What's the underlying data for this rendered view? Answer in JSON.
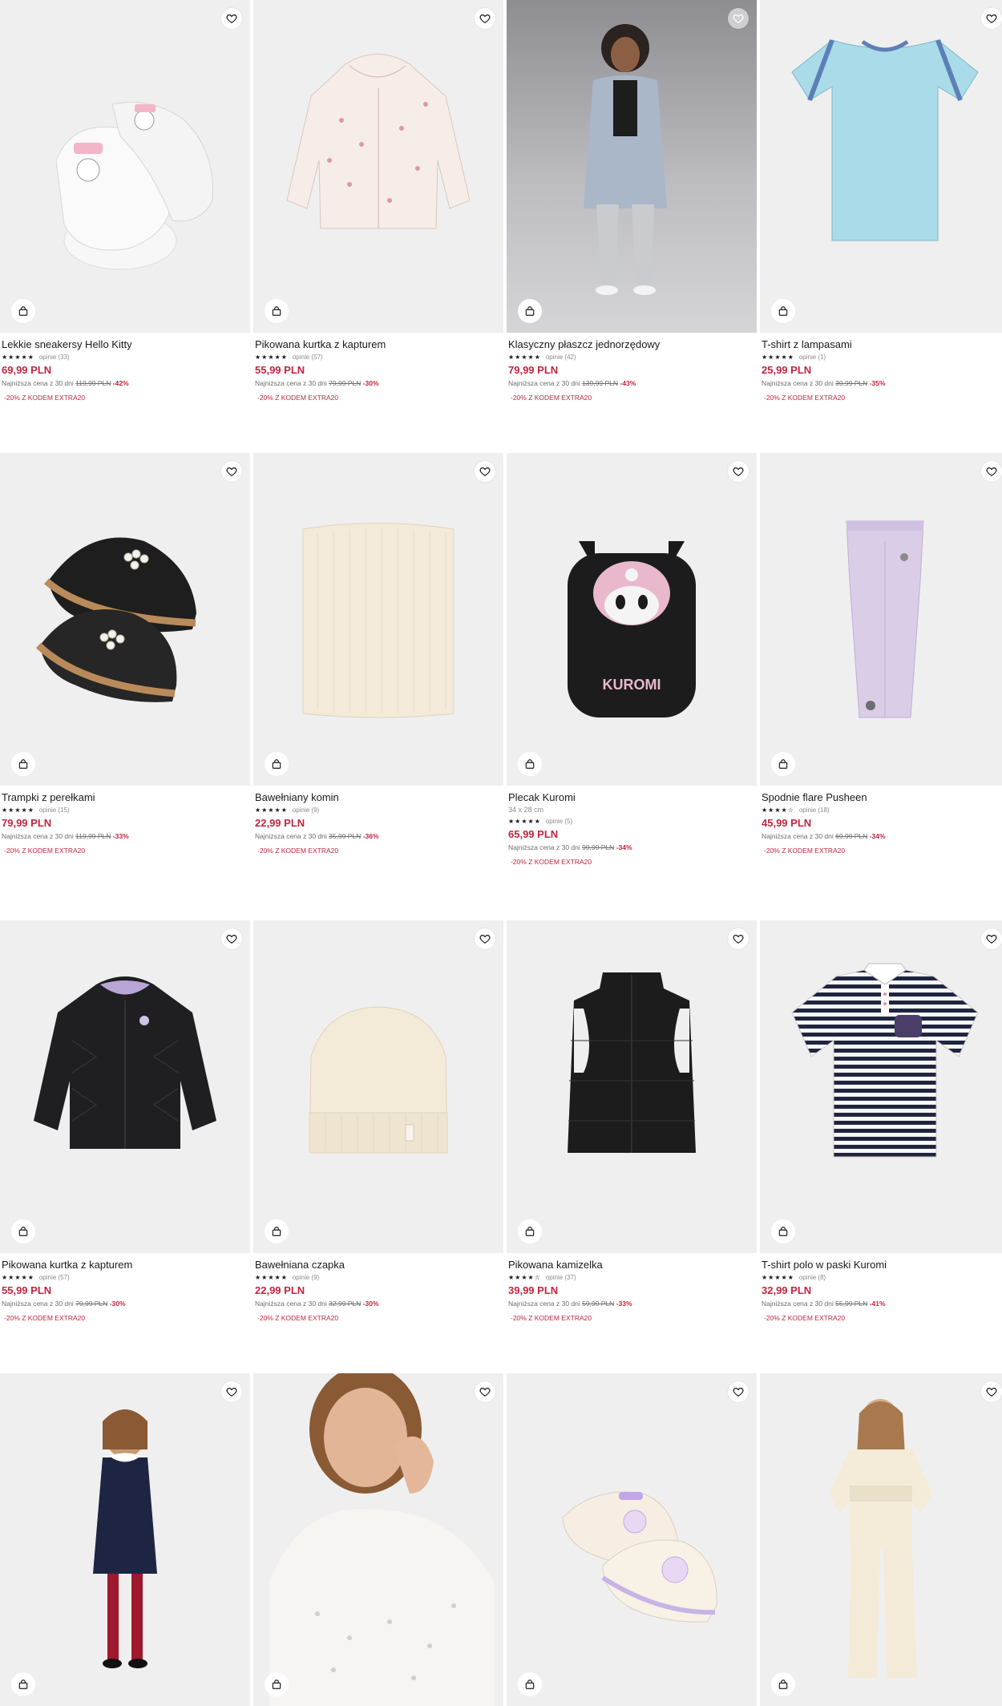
{
  "accent_color": "#c3253f",
  "icons": {
    "favorite": "heart-outline-icon",
    "add_to_bag": "shopping-bag-icon",
    "rating": "star-icon"
  },
  "products": [
    {
      "name": "Lekkie sneakersy Hello Kitty",
      "stars": "★★★★★",
      "reviews": "opinie (33)",
      "price": "69,99 PLN",
      "lowest_label": "Najniższa cena z 30 dni",
      "old_price": "119,99 PLN",
      "discount": "-42%",
      "code": "-20% Z KODEM EXTRA20"
    },
    {
      "name": "Pikowana kurtka z kapturem",
      "stars": "★★★★★",
      "reviews": "opinie (57)",
      "price": "55,99 PLN",
      "lowest_label": "Najniższa cena z 30 dni",
      "old_price": "79,99 PLN",
      "discount": "-30%",
      "code": "-20% Z KODEM EXTRA20"
    },
    {
      "name": "Klasyczny płaszcz jednorzędowy",
      "stars": "★★★★★",
      "reviews": "opinie (42)",
      "price": "79,99 PLN",
      "lowest_label": "Najniższa cena z 30 dni",
      "old_price": "139,99 PLN",
      "discount": "-43%",
      "code": "-20% Z KODEM EXTRA20"
    },
    {
      "name": "T-shirt z lampasami",
      "stars": "★★★★★",
      "reviews": "opinie (1)",
      "price": "25,99 PLN",
      "lowest_label": "Najniższa cena z 30 dni",
      "old_price": "39,99 PLN",
      "discount": "-35%",
      "code": "-20% Z KODEM EXTRA20"
    },
    {
      "name": "Trampki z perełkami",
      "stars": "★★★★★",
      "reviews": "opinie (15)",
      "price": "79,99 PLN",
      "lowest_label": "Najniższa cena z 30 dni",
      "old_price": "119,99 PLN",
      "discount": "-33%",
      "code": "-20% Z KODEM EXTRA20"
    },
    {
      "name": "Bawełniany komin",
      "stars": "★★★★★",
      "reviews": "opinie (9)",
      "price": "22,99 PLN",
      "lowest_label": "Najniższa cena z 30 dni",
      "old_price": "35,99 PLN",
      "discount": "-36%",
      "code": "-20% Z KODEM EXTRA20"
    },
    {
      "name": "Plecak Kuromi",
      "dims": "34 x 28 cm",
      "stars": "★★★★★",
      "reviews": "opinie (5)",
      "price": "65,99 PLN",
      "lowest_label": "Najniższa cena z 30 dni",
      "old_price": "99,99 PLN",
      "discount": "-34%",
      "code": "-20% Z KODEM EXTRA20"
    },
    {
      "name": "Spodnie flare Pusheen",
      "stars": "★★★★☆",
      "reviews": "opinie (18)",
      "price": "45,99 PLN",
      "lowest_label": "Najniższa cena z 30 dni",
      "old_price": "69,99 PLN",
      "discount": "-34%",
      "code": "-20% Z KODEM EXTRA20"
    },
    {
      "name": "Pikowana kurtka z kapturem",
      "stars": "★★★★★",
      "reviews": "opinie (57)",
      "price": "55,99 PLN",
      "lowest_label": "Najniższa cena z 30 dni",
      "old_price": "79,99 PLN",
      "discount": "-30%",
      "code": "-20% Z KODEM EXTRA20"
    },
    {
      "name": "Bawełniana czapka",
      "stars": "★★★★★",
      "reviews": "opinie (9)",
      "price": "22,99 PLN",
      "lowest_label": "Najniższa cena z 30 dni",
      "old_price": "32,99 PLN",
      "discount": "-30%",
      "code": "-20% Z KODEM EXTRA20"
    },
    {
      "name": "Pikowana kamizelka",
      "stars": "★★★★☆",
      "reviews": "opinie (37)",
      "price": "39,99 PLN",
      "lowest_label": "Najniższa cena z 30 dni",
      "old_price": "59,99 PLN",
      "discount": "-33%",
      "code": "-20% Z KODEM EXTRA20"
    },
    {
      "name": "T-shirt polo w paski Kuromi",
      "stars": "★★★★★",
      "reviews": "opinie (8)",
      "price": "32,99 PLN",
      "lowest_label": "Najniższa cena z 30 dni",
      "old_price": "55,99 PLN",
      "discount": "-41%",
      "code": "-20% Z KODEM EXTRA20"
    },
    {
      "name": "",
      "price": ""
    },
    {
      "name": "",
      "price": ""
    },
    {
      "name": "",
      "price": ""
    },
    {
      "name": "",
      "price": ""
    }
  ]
}
